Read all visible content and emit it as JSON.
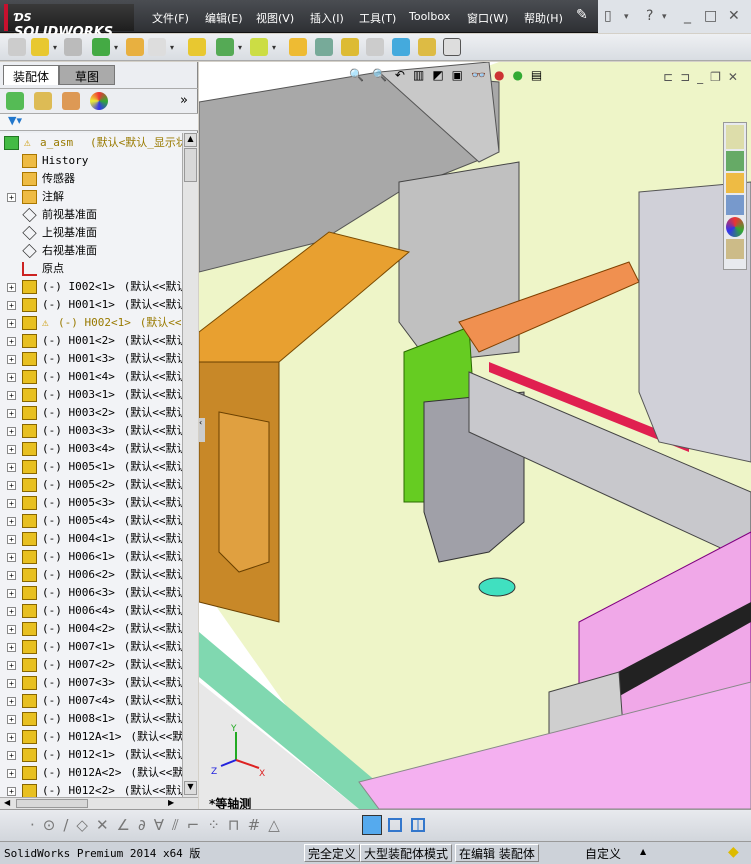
{
  "app": {
    "logo": "SOLIDWORKS",
    "menu": [
      "文件(F)",
      "编辑(E)",
      "视图(V)",
      "插入(I)",
      "工具(T)",
      "Toolbox",
      "窗口(W)",
      "帮助(H)"
    ]
  },
  "panel": {
    "tabs": [
      "装配体",
      "草图"
    ]
  },
  "tree": [
    {
      "label": "a_asm",
      "suffix": "(默认<默认_显示状",
      "type": "assembly",
      "warning": true
    },
    {
      "label": "History",
      "suffix": "",
      "type": "history"
    },
    {
      "label": "传感器",
      "suffix": "",
      "type": "sensor"
    },
    {
      "label": "注解",
      "suffix": "",
      "type": "annotation",
      "expand": true
    },
    {
      "label": "前视基准面",
      "suffix": "",
      "type": "plane"
    },
    {
      "label": "上视基准面",
      "suffix": "",
      "type": "plane"
    },
    {
      "label": "右视基准面",
      "suffix": "",
      "type": "plane"
    },
    {
      "label": "原点",
      "suffix": "",
      "type": "origin"
    },
    {
      "label": "(-) I002<1>",
      "suffix": "(默认<<默认",
      "type": "part",
      "expand": true
    },
    {
      "label": "(-) H001<1>",
      "suffix": "(默认<<默认",
      "type": "part",
      "expand": true
    },
    {
      "label": "(-) H002<1>",
      "suffix": "(默认<<默",
      "type": "part",
      "expand": true,
      "warning": true
    },
    {
      "label": "(-) H001<2>",
      "suffix": "(默认<<默认",
      "type": "part",
      "expand": true
    },
    {
      "label": "(-) H001<3>",
      "suffix": "(默认<<默认",
      "type": "part",
      "expand": true
    },
    {
      "label": "(-) H001<4>",
      "suffix": "(默认<<默认",
      "type": "part",
      "expand": true
    },
    {
      "label": "(-) H003<1>",
      "suffix": "(默认<<默认",
      "type": "part",
      "expand": true
    },
    {
      "label": "(-) H003<2>",
      "suffix": "(默认<<默认",
      "type": "part",
      "expand": true
    },
    {
      "label": "(-) H003<3>",
      "suffix": "(默认<<默认",
      "type": "part",
      "expand": true
    },
    {
      "label": "(-) H003<4>",
      "suffix": "(默认<<默认",
      "type": "part",
      "expand": true
    },
    {
      "label": "(-) H005<1>",
      "suffix": "(默认<<默认",
      "type": "part",
      "expand": true
    },
    {
      "label": "(-) H005<2>",
      "suffix": "(默认<<默认",
      "type": "part",
      "expand": true
    },
    {
      "label": "(-) H005<3>",
      "suffix": "(默认<<默认",
      "type": "part",
      "expand": true
    },
    {
      "label": "(-) H005<4>",
      "suffix": "(默认<<默认",
      "type": "part",
      "expand": true
    },
    {
      "label": "(-) H004<1>",
      "suffix": "(默认<<默认",
      "type": "part",
      "expand": true
    },
    {
      "label": "(-) H006<1>",
      "suffix": "(默认<<默认",
      "type": "part",
      "expand": true
    },
    {
      "label": "(-) H006<2>",
      "suffix": "(默认<<默认",
      "type": "part",
      "expand": true
    },
    {
      "label": "(-) H006<3>",
      "suffix": "(默认<<默认",
      "type": "part",
      "expand": true
    },
    {
      "label": "(-) H006<4>",
      "suffix": "(默认<<默认",
      "type": "part",
      "expand": true
    },
    {
      "label": "(-) H004<2>",
      "suffix": "(默认<<默认",
      "type": "part",
      "expand": true
    },
    {
      "label": "(-) H007<1>",
      "suffix": "(默认<<默认",
      "type": "part",
      "expand": true
    },
    {
      "label": "(-) H007<2>",
      "suffix": "(默认<<默认",
      "type": "part",
      "expand": true
    },
    {
      "label": "(-) H007<3>",
      "suffix": "(默认<<默认",
      "type": "part",
      "expand": true
    },
    {
      "label": "(-) H007<4>",
      "suffix": "(默认<<默认",
      "type": "part",
      "expand": true
    },
    {
      "label": "(-) H008<1>",
      "suffix": "(默认<<默认",
      "type": "part",
      "expand": true
    },
    {
      "label": "(-) H012A<1>",
      "suffix": "(默认<<默认",
      "type": "part",
      "expand": true
    },
    {
      "label": "(-) H012<1>",
      "suffix": "(默认<<默认",
      "type": "part",
      "expand": true
    },
    {
      "label": "(-) H012A<2>",
      "suffix": "(默认<<默认",
      "type": "part",
      "expand": true
    },
    {
      "label": "(-) H012<2>",
      "suffix": "(默认<<默认",
      "type": "part",
      "expand": true
    }
  ],
  "viewport": {
    "view_name": "*等轴测",
    "triad": {
      "x": "X",
      "y": "Y",
      "z": "Z"
    }
  },
  "status": {
    "product": "SolidWorks Premium 2014 x64 版",
    "definition": "完全定义",
    "mode": "大型装配体模式",
    "editing": "在编辑 装配体",
    "units": "自定义"
  },
  "colors": {
    "titlebar": "#2e3034",
    "accent": "#c8102e",
    "floor": "#eef5c8",
    "orange": "#e8a030",
    "green": "#66cc22",
    "pink": "#f0a8e8"
  }
}
